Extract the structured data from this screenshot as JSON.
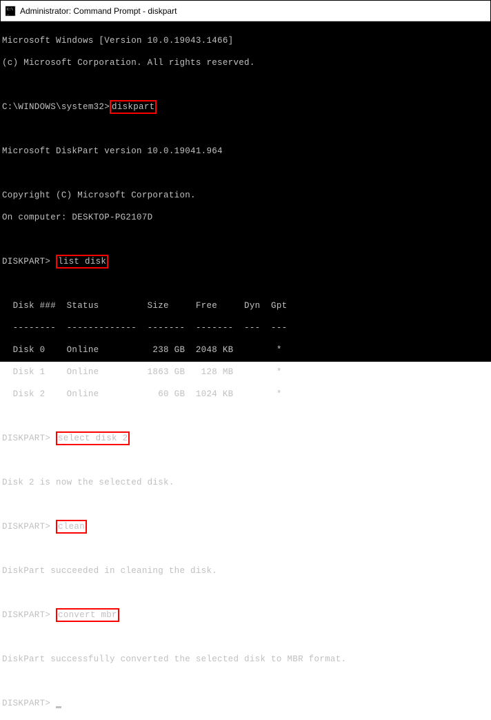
{
  "titlebar": {
    "title": "Administrator: Command Prompt - diskpart"
  },
  "terminal": {
    "version_line": "Microsoft Windows [Version 10.0.19043.1466]",
    "copyright_line": "(c) Microsoft Corporation. All rights reserved.",
    "prompt1_prefix": "C:\\WINDOWS\\system32>",
    "cmd1": "diskpart",
    "diskpart_version": "Microsoft DiskPart version 10.0.19041.964",
    "diskpart_copyright": "Copyright (C) Microsoft Corporation.",
    "computer_line": "On computer: DESKTOP-PG2107D",
    "diskpart_prompt": "DISKPART> ",
    "cmd2": "list disk",
    "table_header": "  Disk ###  Status         Size     Free     Dyn  Gpt",
    "table_divider": "  --------  -------------  -------  -------  ---  ---",
    "table_row0": "  Disk 0    Online          238 GB  2048 KB        *",
    "table_row1": "  Disk 1    Online         1863 GB   128 MB        *",
    "table_row2": "  Disk 2    Online           60 GB  1024 KB        *",
    "cmd3": "select disk 2",
    "result3": "Disk 2 is now the selected disk.",
    "cmd4": "clean",
    "result4": "DiskPart succeeded in cleaning the disk.",
    "cmd5": "convert mbr",
    "result5": "DiskPart successfully converted the selected disk to MBR format."
  }
}
